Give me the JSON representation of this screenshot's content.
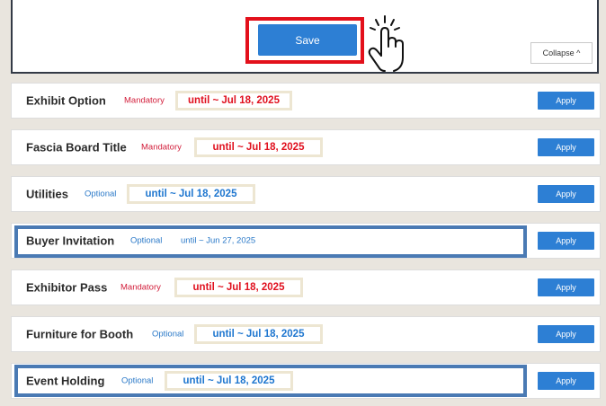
{
  "panel": {
    "save_label": "Save",
    "collapse_label": "Collapse ^"
  },
  "rows": [
    {
      "title": "Exhibit Option",
      "status": "Mandatory",
      "date": "until ~ Jul 18, 2025",
      "apply": "Apply"
    },
    {
      "title": "Fascia Board Title",
      "status": "Mandatory",
      "date": "until ~ Jul 18, 2025",
      "apply": "Apply"
    },
    {
      "title": "Utilities",
      "status": "Optional",
      "date": "until ~ Jul 18, 2025",
      "apply": "Apply"
    },
    {
      "title": "Buyer Invitation",
      "status": "Optional",
      "date": "until ~ Jun 27, 2025",
      "apply": "Apply"
    },
    {
      "title": "Exhibitor Pass",
      "status": "Mandatory",
      "date": "until ~ Jul 18, 2025",
      "apply": "Apply"
    },
    {
      "title": "Furniture for Booth",
      "status": "Optional",
      "date": "until ~ Jul 18, 2025",
      "apply": "Apply"
    },
    {
      "title": "Event Holding",
      "status": "Optional",
      "date": "until ~ Jul 18, 2025",
      "apply": "Apply"
    }
  ],
  "colors": {
    "accent": "#2d7fd4",
    "mandatory": "#d21d3a",
    "optional": "#2a79c8",
    "save_highlight": "#e3101b",
    "row_highlight": "#4a7ab4"
  },
  "icons": {
    "pointer": "hand-pointer-icon"
  }
}
